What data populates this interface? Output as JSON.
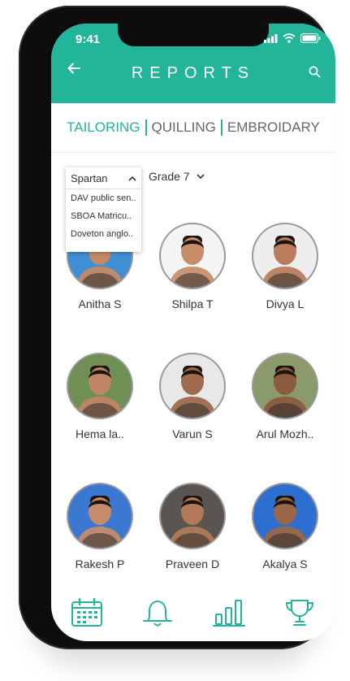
{
  "status": {
    "time": "9:41"
  },
  "header": {
    "title": "REPORTS"
  },
  "tabs": [
    {
      "label": "TAILORING",
      "active": true
    },
    {
      "label": "QUILLING",
      "active": false
    },
    {
      "label": "EMBROIDARY",
      "active": false
    }
  ],
  "filters": {
    "school_selected": "Spartan",
    "school_options": [
      "DAV public sen..",
      "SBOA Matricu..",
      "Doveton anglo.."
    ],
    "grade": "Grade 7"
  },
  "students": [
    {
      "name": "Anitha S",
      "bg": "#3f8fd4",
      "skin": "#c58a63"
    },
    {
      "name": "Shilpa T",
      "bg": "#f4f4f4",
      "skin": "#c88e6a"
    },
    {
      "name": "Divya L",
      "bg": "#eeeeee",
      "skin": "#b97d5c"
    },
    {
      "name": "Hema la..",
      "bg": "#6f8f55",
      "skin": "#c08565"
    },
    {
      "name": "Varun S",
      "bg": "#e8e8e8",
      "skin": "#9e6a4c"
    },
    {
      "name": "Arul Mozh..",
      "bg": "#8a9a6a",
      "skin": "#8c5a3e"
    },
    {
      "name": "Rakesh P",
      "bg": "#3a78d2",
      "skin": "#c58b6a"
    },
    {
      "name": "Praveen D",
      "bg": "#5a5550",
      "skin": "#b07a58"
    },
    {
      "name": "Akalya S",
      "bg": "#2d6fd0",
      "skin": "#9b6647"
    }
  ],
  "colors": {
    "accent": "#22b59a"
  },
  "nav": [
    "calendar-icon",
    "bell-icon",
    "bar-chart-icon",
    "trophy-icon"
  ]
}
